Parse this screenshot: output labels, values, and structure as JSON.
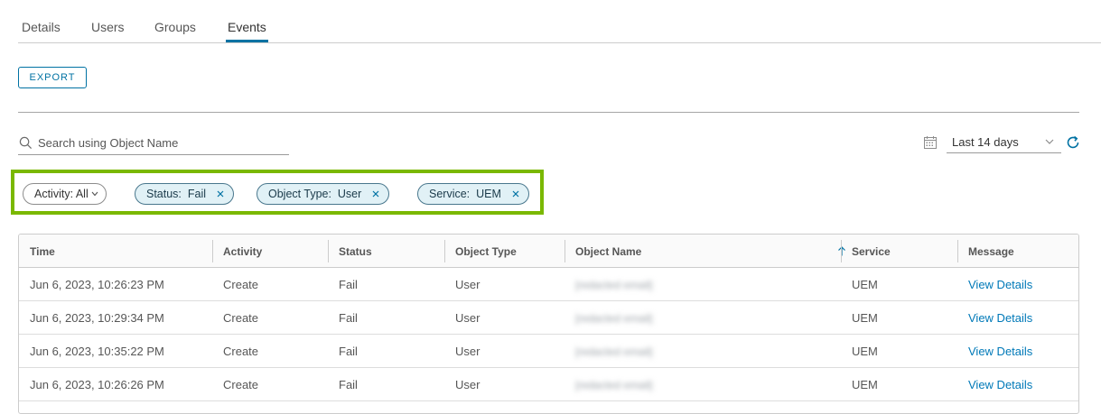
{
  "tabs": [
    {
      "label": "Details"
    },
    {
      "label": "Users"
    },
    {
      "label": "Groups"
    },
    {
      "label": "Events"
    }
  ],
  "active_tab": "Events",
  "toolbar": {
    "export_label": "EXPORT"
  },
  "search": {
    "placeholder": "Search using Object Name",
    "value": ""
  },
  "date_range": {
    "selected": "Last 14 days"
  },
  "filters": {
    "activity": "Activity: All",
    "status": "Status:  Fail",
    "object_type": "Object Type:  User",
    "service": "Service:  UEM"
  },
  "table": {
    "columns": [
      "Time",
      "Activity",
      "Status",
      "Object Type",
      "Object Name",
      "Service",
      "Message"
    ],
    "sort_column": "Object Name",
    "sort_direction": "ascending",
    "rows": [
      {
        "time": "Jun 6, 2023, 10:26:23 PM",
        "activity": "Create",
        "status": "Fail",
        "object_type": "User",
        "object_name": "[redacted email]",
        "service": "UEM",
        "message": "View Details"
      },
      {
        "time": "Jun 6, 2023, 10:29:34 PM",
        "activity": "Create",
        "status": "Fail",
        "object_type": "User",
        "object_name": "[redacted email]",
        "service": "UEM",
        "message": "View Details"
      },
      {
        "time": "Jun 6, 2023, 10:35:22 PM",
        "activity": "Create",
        "status": "Fail",
        "object_type": "User",
        "object_name": "[redacted email]",
        "service": "UEM",
        "message": "View Details"
      },
      {
        "time": "Jun 6, 2023, 10:26:26 PM",
        "activity": "Create",
        "status": "Fail",
        "object_type": "User",
        "object_name": "[redacted email]",
        "service": "UEM",
        "message": "View Details"
      }
    ]
  },
  "colors": {
    "accent": "#0072a3",
    "highlight": "#7ab800",
    "chip_fill": "#e1f1f6",
    "link": "#0079b8"
  }
}
